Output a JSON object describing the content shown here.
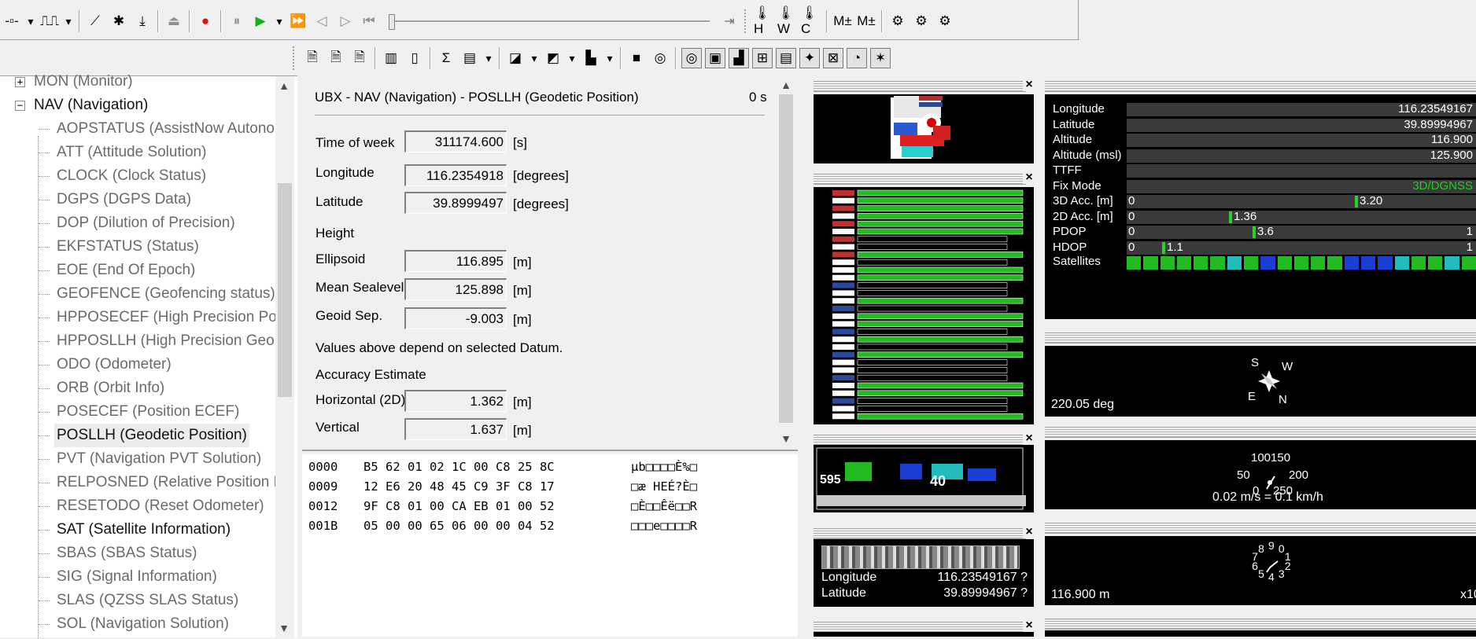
{
  "toolbar_top": {
    "buttons": [
      {
        "name": "connection-icon",
        "glyph": "-▫-"
      },
      {
        "name": "dropdown-arrow-icon",
        "glyph": "▾"
      },
      {
        "name": "baudrate-icon",
        "glyph": "⎍⎍"
      },
      {
        "name": "dropdown-arrow-icon",
        "glyph": "▾"
      },
      {
        "name": "magic-wand-icon",
        "glyph": "⟋"
      },
      {
        "name": "debug-bug-icon",
        "glyph": "✱"
      },
      {
        "name": "download-icon",
        "glyph": "⤓"
      },
      {
        "name": "eject-icon",
        "glyph": "⏏"
      },
      {
        "name": "record-icon",
        "glyph": "●"
      },
      {
        "name": "pause-icon",
        "glyph": "⏸"
      },
      {
        "name": "play-icon",
        "glyph": "▶"
      },
      {
        "name": "dropdown-arrow-icon",
        "glyph": "▾"
      },
      {
        "name": "fast-forward-icon",
        "glyph": "⏩"
      },
      {
        "name": "step-back-icon",
        "glyph": "◁"
      },
      {
        "name": "step-forward-icon",
        "glyph": "▷"
      },
      {
        "name": "rewind-start-icon",
        "glyph": "⏮"
      }
    ],
    "right_buttons": [
      {
        "name": "hot-start-icon",
        "glyph": "🌡H"
      },
      {
        "name": "warm-start-icon",
        "glyph": "🌡W"
      },
      {
        "name": "cold-start-icon",
        "glyph": "🌡C"
      },
      {
        "name": "msg-add-icon",
        "glyph": "M±"
      },
      {
        "name": "msg-add-alt-icon",
        "glyph": "M±"
      },
      {
        "name": "receiver-config-icon",
        "glyph": "⚙"
      },
      {
        "name": "receiver-config-alt-icon",
        "glyph": "⚙"
      },
      {
        "name": "receiver-reset-icon",
        "glyph": "⚙"
      }
    ]
  },
  "toolbar_views": {
    "buttons": [
      {
        "name": "docs-icon",
        "glyph": "🗎",
        "pressed": false
      },
      {
        "name": "docs-alt-icon",
        "glyph": "🗎",
        "pressed": false
      },
      {
        "name": "docs-alt2-icon",
        "glyph": "🗎",
        "pressed": false
      },
      {
        "name": "packet-console-icon",
        "glyph": "▥",
        "pressed": false
      },
      {
        "name": "binary-console-icon",
        "glyph": "▯",
        "pressed": false
      },
      {
        "name": "statistics-icon",
        "glyph": "Σ",
        "pressed": false
      },
      {
        "name": "table-view-icon",
        "glyph": "▤",
        "pressed": false
      },
      {
        "name": "dropdown-arrow-icon",
        "glyph": "▾",
        "pressed": false
      },
      {
        "name": "map-view-icon",
        "glyph": "◪",
        "pressed": false
      },
      {
        "name": "dropdown-arrow-icon",
        "glyph": "▾",
        "pressed": false
      },
      {
        "name": "chart-view-icon",
        "glyph": "◩",
        "pressed": false
      },
      {
        "name": "dropdown-arrow-icon",
        "glyph": "▾",
        "pressed": false
      },
      {
        "name": "histogram-view-icon",
        "glyph": "▙",
        "pressed": false
      },
      {
        "name": "dropdown-arrow-icon",
        "glyph": "▾",
        "pressed": false
      },
      {
        "name": "camera-view-icon",
        "glyph": "■",
        "pressed": false
      },
      {
        "name": "deviation-map-icon",
        "glyph": "◎",
        "pressed": false
      },
      {
        "name": "sky-view-icon",
        "glyph": "◎",
        "pressed": true
      },
      {
        "name": "world-map-icon",
        "glyph": "▣",
        "pressed": true
      },
      {
        "name": "signal-bars-icon",
        "glyph": "▟",
        "pressed": true
      },
      {
        "name": "sat-signal-icon",
        "glyph": "⊞",
        "pressed": true
      },
      {
        "name": "data-view-icon",
        "glyph": "▤",
        "pressed": true
      },
      {
        "name": "compass-view-icon",
        "glyph": "✦",
        "pressed": true
      },
      {
        "name": "speed-view-icon",
        "glyph": "⊠",
        "pressed": true
      },
      {
        "name": "clock-view-icon",
        "glyph": "◔",
        "pressed": true
      },
      {
        "name": "altitude-view-icon",
        "glyph": "✶",
        "pressed": true
      }
    ]
  },
  "tree": {
    "items": [
      {
        "expander": "+",
        "label": "MON (Monitor)",
        "level": 0,
        "style": "gray"
      },
      {
        "expander": "−",
        "label": "NAV (Navigation)",
        "level": 0,
        "style": "dark"
      },
      {
        "label": "AOPSTATUS (AssistNow Autono",
        "level": 1,
        "style": "gray"
      },
      {
        "label": "ATT (Attitude Solution)",
        "level": 1,
        "style": "gray"
      },
      {
        "label": "CLOCK (Clock Status)",
        "level": 1,
        "style": "gray"
      },
      {
        "label": "DGPS (DGPS Data)",
        "level": 1,
        "style": "gray"
      },
      {
        "label": "DOP (Dilution of Precision)",
        "level": 1,
        "style": "gray"
      },
      {
        "label": "EKFSTATUS (Status)",
        "level": 1,
        "style": "gray"
      },
      {
        "label": "EOE (End Of Epoch)",
        "level": 1,
        "style": "gray"
      },
      {
        "label": "GEOFENCE (Geofencing status)",
        "level": 1,
        "style": "gray"
      },
      {
        "label": "HPPOSECEF (High Precision Pos",
        "level": 1,
        "style": "gray"
      },
      {
        "label": "HPPOSLLH (High Precision Geo",
        "level": 1,
        "style": "gray"
      },
      {
        "label": "ODO (Odometer)",
        "level": 1,
        "style": "gray"
      },
      {
        "label": "ORB (Orbit Info)",
        "level": 1,
        "style": "gray"
      },
      {
        "label": "POSECEF (Position ECEF)",
        "level": 1,
        "style": "gray"
      },
      {
        "label": "POSLLH (Geodetic Position)",
        "level": 1,
        "style": "selected"
      },
      {
        "label": "PVT (Navigation PVT Solution)",
        "level": 1,
        "style": "gray"
      },
      {
        "label": "RELPOSNED (Relative Position N",
        "level": 1,
        "style": "gray"
      },
      {
        "label": "RESETODO (Reset Odometer)",
        "level": 1,
        "style": "gray"
      },
      {
        "label": "SAT (Satellite Information)",
        "level": 1,
        "style": "dark"
      },
      {
        "label": "SBAS (SBAS Status)",
        "level": 1,
        "style": "gray"
      },
      {
        "label": "SIG (Signal Information)",
        "level": 1,
        "style": "gray"
      },
      {
        "label": "SLAS (QZSS SLAS Status)",
        "level": 1,
        "style": "gray"
      },
      {
        "label": "SOL (Navigation Solution)",
        "level": 1,
        "style": "gray"
      }
    ]
  },
  "message": {
    "title": "UBX - NAV (Navigation) - POSLLH (Geodetic Position)",
    "age": "0 s",
    "tow_label": "Time of week",
    "tow_value": "311174.600",
    "tow_unit": "[s]",
    "lon_label": "Longitude",
    "lon_value": "116.2354918",
    "lon_unit": "[degrees]",
    "lat_label": "Latitude",
    "lat_value": "39.8999497",
    "lat_unit": "[degrees]",
    "height_label": "Height",
    "ell_label": "Ellipsoid",
    "ell_value": "116.895",
    "ell_unit": "[m]",
    "msl_label": "Mean Sealevel",
    "msl_value": "125.898",
    "msl_unit": "[m]",
    "geoid_label": "Geoid Sep.",
    "geoid_value": "-9.003",
    "geoid_unit": "[m]",
    "datum_note": "Values above depend on selected Datum.",
    "acc_label": "Accuracy Estimate",
    "hacc_label": "Horizontal (2D)",
    "hacc_value": "1.362",
    "hacc_unit": "[m]",
    "vacc_label": "Vertical",
    "vacc_value": "1.637",
    "vacc_unit": "[m]"
  },
  "hex": {
    "rows": [
      {
        "offset": "0000",
        "bytes": "B5 62 01 02 1C 00 C8 25 8C",
        "ascii": "µb□□□□È%□"
      },
      {
        "offset": "0009",
        "bytes": "12 E6 20 48 45 C9 3F C8 17",
        "ascii": "□æ HEÉ?È□"
      },
      {
        "offset": "0012",
        "bytes": "9F C8 01 00 CA EB 01 00 52",
        "ascii": "□È□□Êë□□R"
      },
      {
        "offset": "001B",
        "bytes": "05 00 00 65 06 00 00 04 52",
        "ascii": "□□□e□□□□R"
      }
    ]
  },
  "data_view": {
    "rows": [
      {
        "label": "Longitude",
        "value": "116.23549167"
      },
      {
        "label": "Latitude",
        "value": "39.89994967"
      },
      {
        "label": "Altitude",
        "value": "116.900"
      },
      {
        "label": "Altitude (msl)",
        "value": "125.900"
      },
      {
        "label": "TTFF",
        "value": ""
      },
      {
        "label": "Fix Mode",
        "value": "3D/DGNSS"
      }
    ],
    "acc_rows": [
      {
        "label": "3D Acc. [m]",
        "min": "0",
        "marker": "3.20",
        "max": ""
      },
      {
        "label": "2D Acc. [m]",
        "min": "0",
        "marker": "1.36",
        "max": ""
      },
      {
        "label": "PDOP",
        "min": "0",
        "marker": "3.6",
        "max": "1"
      },
      {
        "label": "HDOP",
        "min": "0",
        "marker": "1.1",
        "max": "1"
      }
    ],
    "satellites_label": "Satellites",
    "sat_colors": [
      "#22bb22",
      "#22bb22",
      "#22bb22",
      "#22bb22",
      "#22bb22",
      "#22bb22",
      "#22bbbb",
      "#22bb22",
      "#1a3ed4",
      "#22bb22",
      "#22bb22",
      "#22bb22",
      "#22bb22",
      "#1a3ed4",
      "#1a3ed4",
      "#1a3ed4",
      "#22bbbb",
      "#22bb22",
      "#22bb22",
      "#22bbbb",
      "#22bb22"
    ],
    "fix_color": "#22cc22"
  },
  "compass": {
    "heading": "220.05 deg",
    "n": "N",
    "s": "S",
    "e": "E",
    "w": "W"
  },
  "speed": {
    "scale_top": "100150",
    "scale_left": "50",
    "scale_right": "200",
    "scale_bottom": "0",
    "scale_mid": "250",
    "readout": "0.02 m/s = 0.1 km/h"
  },
  "altitude": {
    "readout": "116.900 m",
    "scale": "x10",
    "digits": [
      "9",
      "0",
      "1",
      "2",
      "3",
      "4",
      "5",
      "6",
      "7",
      "8"
    ]
  },
  "map_view": {
    "lon_label": "Longitude",
    "lon_value": "116.23549167 ?",
    "lat_label": "Latitude",
    "lat_value": "39.89994967 ?"
  },
  "sat_signal": {
    "labels": "595",
    "numbers": "40"
  },
  "colors": {
    "accent_green": "#2bd12b",
    "panel_bg": "#000000",
    "window_bg": "#f0f0f0"
  }
}
